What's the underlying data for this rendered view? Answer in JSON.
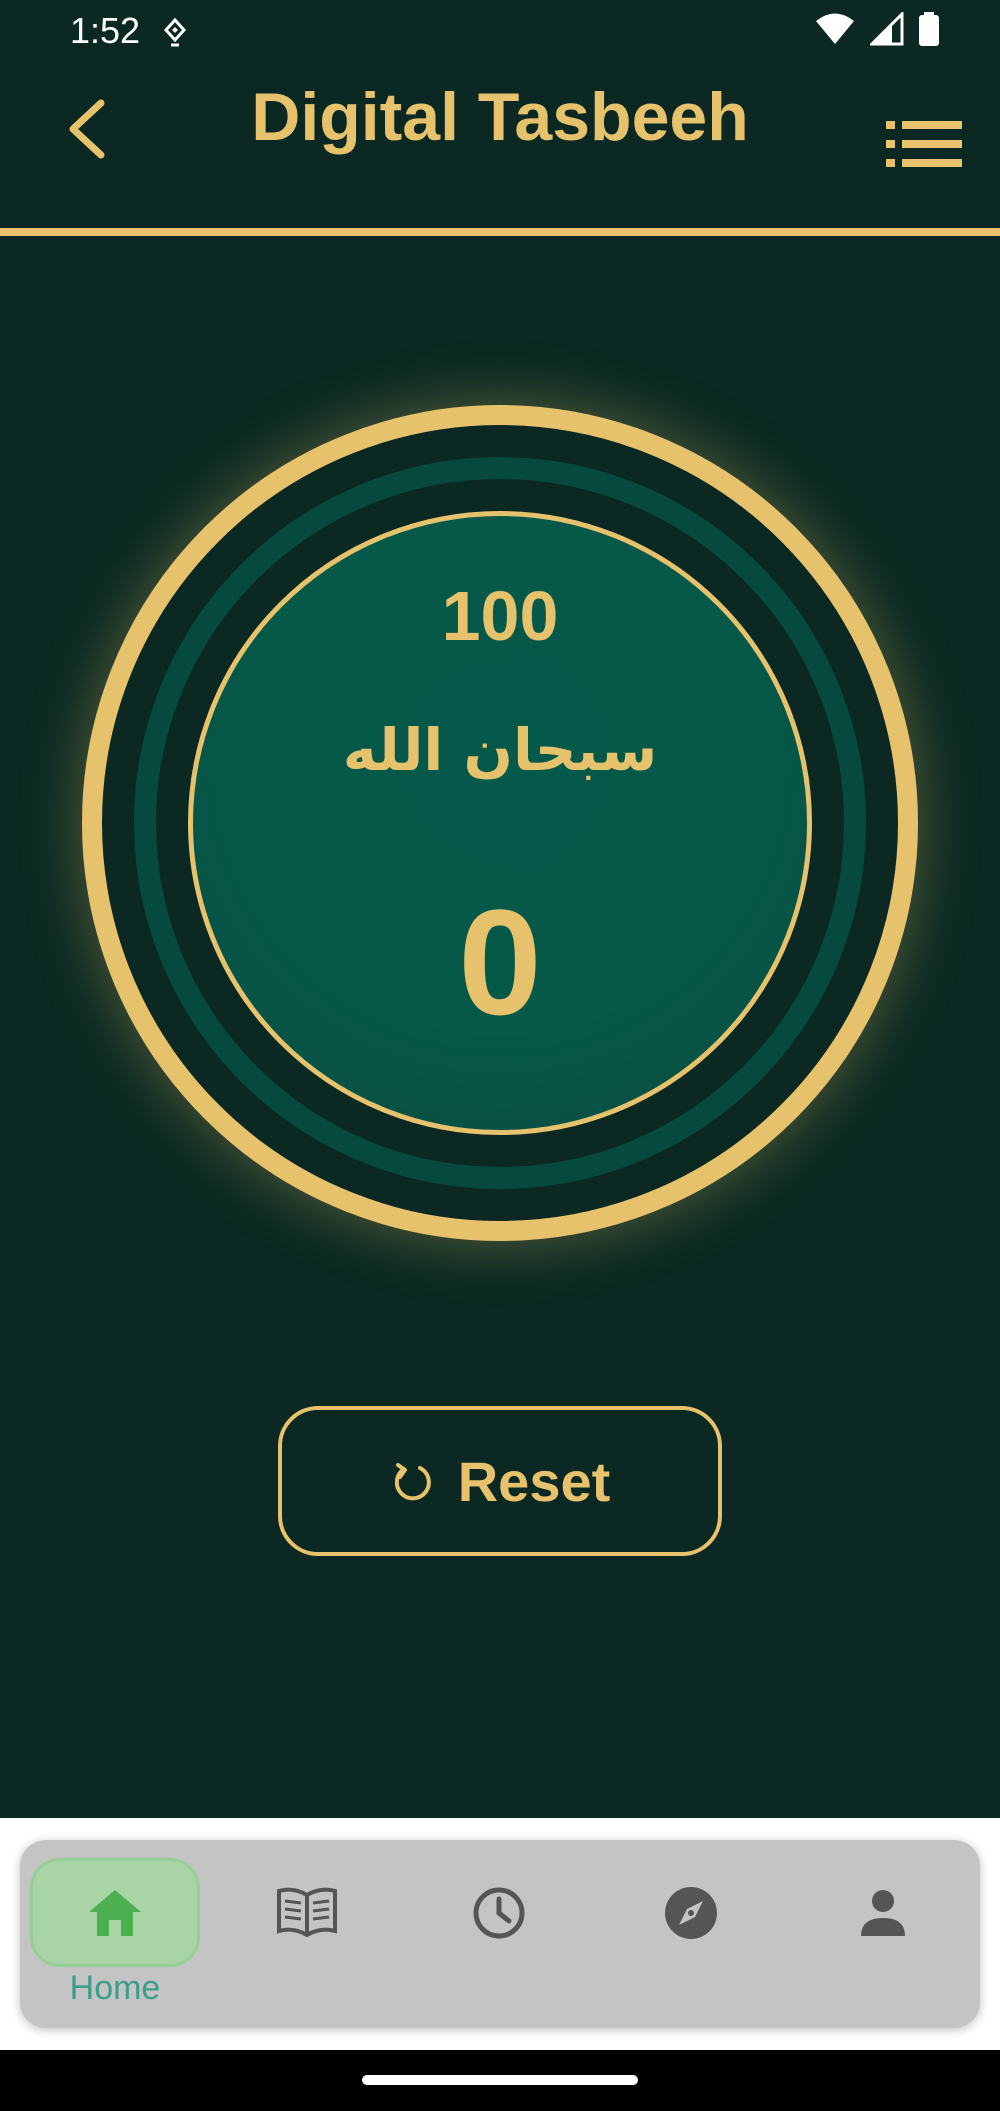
{
  "status_bar": {
    "time": "1:52"
  },
  "app_bar": {
    "title": "Digital Tasbeeh"
  },
  "counter": {
    "target": "100",
    "dhikr": "سبحان الله",
    "count": "0"
  },
  "reset_button": {
    "label": "Reset"
  },
  "bottom_nav": {
    "items": [
      {
        "name": "home",
        "label": "Home",
        "active": true
      },
      {
        "name": "quran",
        "active": false
      },
      {
        "name": "prayer-times",
        "active": false
      },
      {
        "name": "qibla",
        "active": false
      },
      {
        "name": "profile",
        "active": false
      }
    ]
  },
  "colors": {
    "accent": "#e6c26c",
    "background": "#0b2922",
    "counter_fill": "#065848",
    "nav_active": "#4caf50",
    "nav_inactive": "#555555"
  }
}
